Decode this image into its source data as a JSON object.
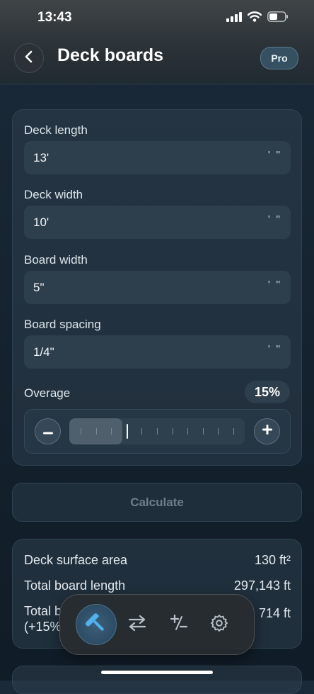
{
  "status_bar": {
    "time": "13:43"
  },
  "header": {
    "title": "Deck boards",
    "pro_label": "Pro"
  },
  "fields": [
    {
      "label": "Deck length",
      "value": "13'",
      "unit": "' \""
    },
    {
      "label": "Deck width",
      "value": "10'",
      "unit": "' \""
    },
    {
      "label": "Board width",
      "value": "5\"",
      "unit": "' \""
    },
    {
      "label": "Board spacing",
      "value": "1/4\"",
      "unit": "' \""
    }
  ],
  "overage": {
    "label": "Overage",
    "value_text": "15%",
    "level_percent": 15
  },
  "calculate_label": "Calculate",
  "results": [
    {
      "label": "Deck surface area",
      "value": "130 ft²"
    },
    {
      "label": "Total board length",
      "value": "297,143 ft"
    },
    {
      "label": "Total b",
      "label_line2": "(+15%",
      "value": "714 ft"
    }
  ],
  "tabbar": {
    "tabs": [
      {
        "icon": "hammer-icon",
        "active": true
      },
      {
        "icon": "swap-arrows-icon",
        "active": false
      },
      {
        "icon": "plus-minus-icon",
        "active": false
      },
      {
        "icon": "gear-icon",
        "active": false
      }
    ]
  },
  "colors": {
    "accent": "#4fb3ee",
    "pro_badge": "#345061",
    "background": "#14222f"
  }
}
